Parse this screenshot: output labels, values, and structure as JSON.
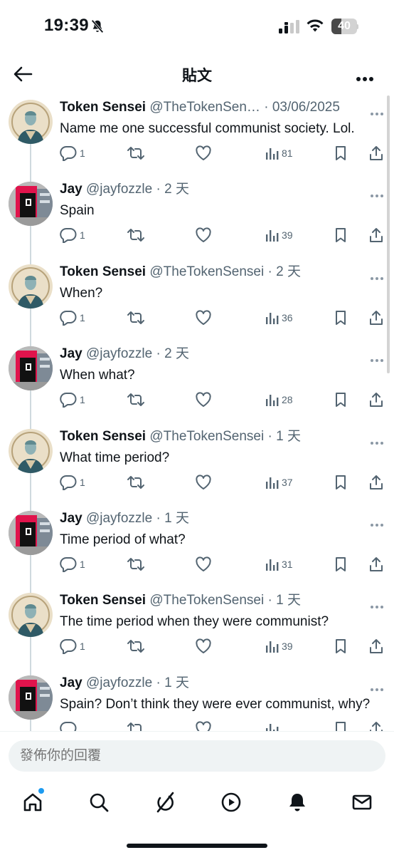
{
  "status_bar": {
    "time": "19:39",
    "battery": "40",
    "battery_level": 0.4
  },
  "header": {
    "title": "貼文"
  },
  "tweets": [
    {
      "name": "Token Sensei",
      "handle": "@TheTokenSen…",
      "sep": "·",
      "time": "03/06/2025",
      "text": "Name me one successful communist society. Lol.",
      "replies": "1",
      "views": "81",
      "avatar": "sensei"
    },
    {
      "name": "Jay",
      "handle": "@jayfozzle",
      "sep": "·",
      "time": "2 天",
      "text": "Spain",
      "replies": "1",
      "views": "39",
      "avatar": "jay"
    },
    {
      "name": "Token Sensei",
      "handle": "@TheTokenSensei",
      "sep": "·",
      "time": "2 天",
      "text": "When?",
      "replies": "1",
      "views": "36",
      "avatar": "sensei"
    },
    {
      "name": "Jay",
      "handle": "@jayfozzle",
      "sep": "·",
      "time": "2 天",
      "text": "When what?",
      "replies": "1",
      "views": "28",
      "avatar": "jay"
    },
    {
      "name": "Token Sensei",
      "handle": "@TheTokenSensei",
      "sep": "·",
      "time": "1 天",
      "text": "What time period?",
      "replies": "1",
      "views": "37",
      "avatar": "sensei"
    },
    {
      "name": "Jay",
      "handle": "@jayfozzle",
      "sep": "·",
      "time": "1 天",
      "text": "Time period of what?",
      "replies": "1",
      "views": "31",
      "avatar": "jay"
    },
    {
      "name": "Token Sensei",
      "handle": "@TheTokenSensei",
      "sep": "·",
      "time": "1 天",
      "text": "The time period when they were communist?",
      "replies": "1",
      "views": "39",
      "avatar": "sensei"
    },
    {
      "name": "Jay",
      "handle": "@jayfozzle",
      "sep": "·",
      "time": "1 天",
      "text": "Spain? Don’t think they were ever communist, why?",
      "replies": "",
      "views": "",
      "avatar": "jay"
    }
  ],
  "reply": {
    "placeholder": "發佈你的回覆"
  },
  "nav": {
    "items": [
      "home-icon",
      "search-icon",
      "grok-icon",
      "play-icon",
      "notifications-icon",
      "messages-icon"
    ]
  },
  "colors": {
    "accent": "#1d9bf0",
    "text": "#0f1419",
    "secondary": "#536471",
    "jay_red": "#e0144c"
  }
}
